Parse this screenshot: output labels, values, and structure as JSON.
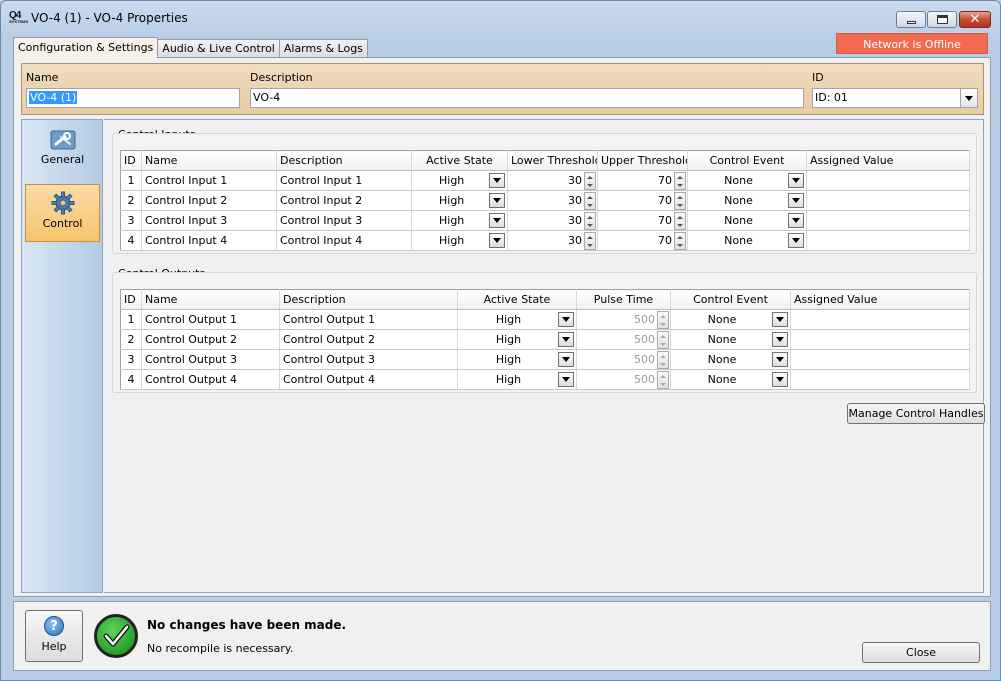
{
  "window": {
    "title": "VO-4 (1) - VO-4 Properties",
    "logo_text": "Q4",
    "logo_sub": "SYSTEMS",
    "close_glyph": "✕"
  },
  "tabs": [
    {
      "label": "Configuration & Settings"
    },
    {
      "label": "Audio & Live Control"
    },
    {
      "label": "Alarms & Logs"
    }
  ],
  "network_status": "Network is Offline",
  "header": {
    "name_label": "Name",
    "name_value": "VO-4 (1)",
    "description_label": "Description",
    "description_value": "VO-4",
    "id_label": "ID",
    "id_value": "ID: 01"
  },
  "sidebar": {
    "items": [
      {
        "label": "General",
        "icon": "wrench-icon"
      },
      {
        "label": "Control",
        "icon": "gear-icon"
      }
    ]
  },
  "control_inputs": {
    "title": "Control Inputs",
    "columns": [
      "ID",
      "Name",
      "Description",
      "Active State",
      "Lower Threshold",
      "Upper Threshold",
      "Control Event",
      "Assigned Value"
    ],
    "rows": [
      {
        "id": "1",
        "name": "Control Input 1",
        "description": "Control Input 1",
        "active_state": "High",
        "lower": "30",
        "upper": "70",
        "event": "None",
        "assigned": ""
      },
      {
        "id": "2",
        "name": "Control Input 2",
        "description": "Control Input 2",
        "active_state": "High",
        "lower": "30",
        "upper": "70",
        "event": "None",
        "assigned": ""
      },
      {
        "id": "3",
        "name": "Control Input 3",
        "description": "Control Input 3",
        "active_state": "High",
        "lower": "30",
        "upper": "70",
        "event": "None",
        "assigned": ""
      },
      {
        "id": "4",
        "name": "Control Input 4",
        "description": "Control Input 4",
        "active_state": "High",
        "lower": "30",
        "upper": "70",
        "event": "None",
        "assigned": ""
      }
    ]
  },
  "control_outputs": {
    "title": "Control Outputs",
    "columns": [
      "ID",
      "Name",
      "Description",
      "Active State",
      "Pulse Time",
      "Control Event",
      "Assigned Value"
    ],
    "rows": [
      {
        "id": "1",
        "name": "Control Output 1",
        "description": "Control Output 1",
        "active_state": "High",
        "pulse": "500",
        "event": "None",
        "assigned": ""
      },
      {
        "id": "2",
        "name": "Control Output 2",
        "description": "Control Output 2",
        "active_state": "High",
        "pulse": "500",
        "event": "None",
        "assigned": ""
      },
      {
        "id": "3",
        "name": "Control Output 3",
        "description": "Control Output 3",
        "active_state": "High",
        "pulse": "500",
        "event": "None",
        "assigned": ""
      },
      {
        "id": "4",
        "name": "Control Output 4",
        "description": "Control Output 4",
        "active_state": "High",
        "pulse": "500",
        "event": "None",
        "assigned": ""
      }
    ]
  },
  "manage_button": "Manage Control Handles",
  "footer": {
    "help_label": "Help",
    "help_glyph": "?",
    "status_main": "No changes have been made.",
    "status_sub": "No recompile is necessary.",
    "close_label": "Close"
  },
  "colors": {
    "network_offline": "#f26b50",
    "header_panel": "#f0dcc0",
    "active_nav": "#f6c46d",
    "ok_green": "#0f8a12"
  }
}
